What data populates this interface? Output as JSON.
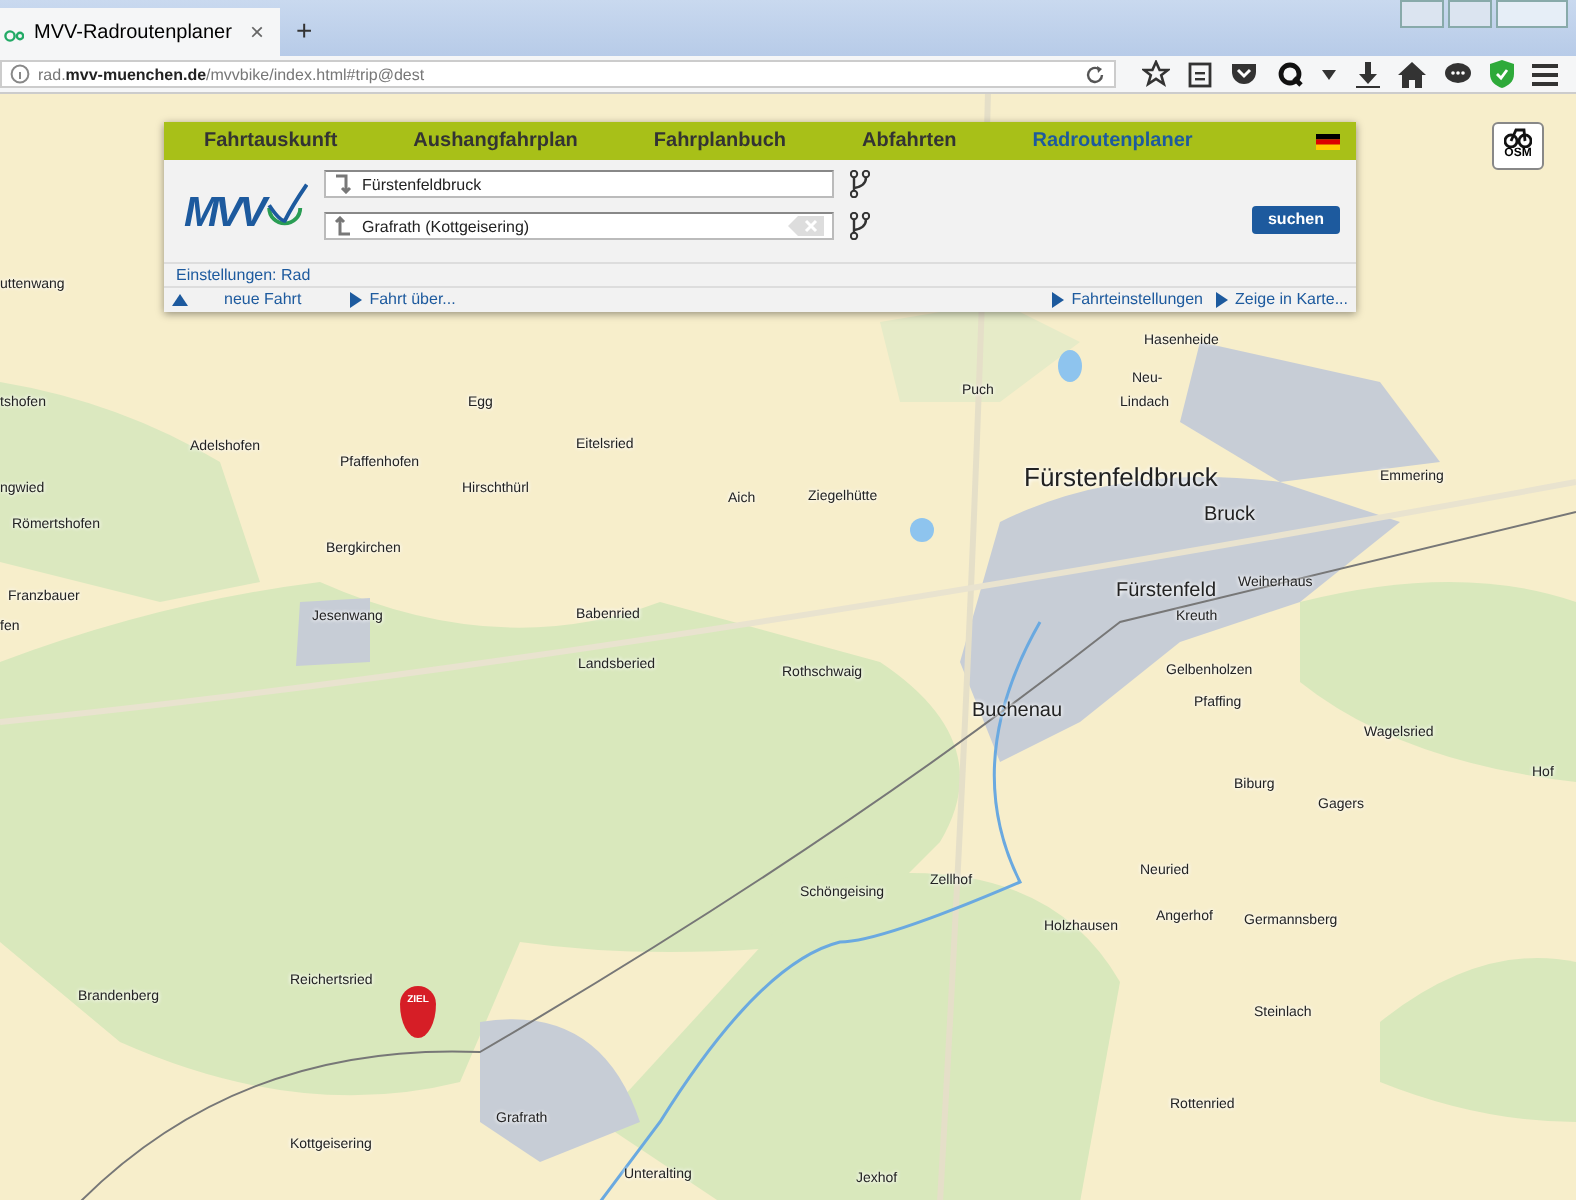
{
  "browser": {
    "tab_title": "MVV-Radroutenplaner",
    "tab_close": "×",
    "new_tab": "+",
    "url": "rad.**mvv-muenchen.de**/mvvbike/index.html#trip@dest"
  },
  "planner": {
    "tabs": [
      {
        "label": "Fahrtauskunft",
        "selected": false
      },
      {
        "label": "Aushangfahrplan",
        "selected": false
      },
      {
        "label": "Fahrplanbuch",
        "selected": false
      },
      {
        "label": "Abfahrten",
        "selected": false
      },
      {
        "label": "Radroutenplaner",
        "selected": true
      }
    ],
    "logo": "MVV",
    "from": {
      "value": "Fürstenfeldbruck"
    },
    "to": {
      "value": "Grafrath (Kottgeisering)"
    },
    "search_button": "suchen",
    "settings": "Einstellungen: Rad",
    "links": [
      {
        "label": "neue Fahrt",
        "kind": "up"
      },
      {
        "label": "Fahrt über...",
        "kind": "right"
      },
      {
        "label": "Fahrteinstellungen",
        "kind": "right"
      },
      {
        "label": "Zeige in Karte...",
        "kind": "right"
      }
    ]
  },
  "osm_button": "OSM",
  "map": {
    "marker": "ZIEL",
    "places": [
      {
        "name": "uttenwang",
        "kind": "village"
      },
      {
        "name": "tshofen",
        "kind": "village"
      },
      {
        "name": "Adelshofen",
        "kind": "village"
      },
      {
        "name": "Egg",
        "kind": "village"
      },
      {
        "name": "Eitelsried",
        "kind": "village"
      },
      {
        "name": "Pfaffenhofen",
        "kind": "village"
      },
      {
        "name": "ngwied",
        "kind": "village"
      },
      {
        "name": "Hirschthürl",
        "kind": "village"
      },
      {
        "name": "Aich",
        "kind": "village"
      },
      {
        "name": "Ziegelhütte",
        "kind": "village"
      },
      {
        "name": "Römertshofen",
        "kind": "village"
      },
      {
        "name": "Bergkirchen",
        "kind": "village"
      },
      {
        "name": "Franzbauer",
        "kind": "village"
      },
      {
        "name": "fen",
        "kind": "village"
      },
      {
        "name": "Jesenwang",
        "kind": "village"
      },
      {
        "name": "Babenried",
        "kind": "village"
      },
      {
        "name": "Landsberied",
        "kind": "village"
      },
      {
        "name": "Rothschwaig",
        "kind": "village"
      },
      {
        "name": "Hasenheide",
        "kind": "village"
      },
      {
        "name": "Puch",
        "kind": "village"
      },
      {
        "name": "Neu-",
        "kind": "village"
      },
      {
        "name": "Lindach",
        "kind": "village"
      },
      {
        "name": "Fürstenfeldbruck",
        "kind": "city"
      },
      {
        "name": "Emmering",
        "kind": "village"
      },
      {
        "name": "Bruck",
        "kind": "town"
      },
      {
        "name": "Fürstenfeld",
        "kind": "town"
      },
      {
        "name": "Weiherhaus",
        "kind": "village"
      },
      {
        "name": "Kreuth",
        "kind": "village"
      },
      {
        "name": "Gelbenholzen",
        "kind": "village"
      },
      {
        "name": "Pfaffing",
        "kind": "village"
      },
      {
        "name": "Buchenau",
        "kind": "town"
      },
      {
        "name": "Wagelsried",
        "kind": "village"
      },
      {
        "name": "Hof",
        "kind": "village"
      },
      {
        "name": "Biburg",
        "kind": "village"
      },
      {
        "name": "Gagers",
        "kind": "village"
      },
      {
        "name": "Neuried",
        "kind": "village"
      },
      {
        "name": "Zellhof",
        "kind": "village"
      },
      {
        "name": "Schöngeising",
        "kind": "village"
      },
      {
        "name": "Holzhausen",
        "kind": "village"
      },
      {
        "name": "Angerhof",
        "kind": "village"
      },
      {
        "name": "Germannsberg",
        "kind": "village"
      },
      {
        "name": "Brandenberg",
        "kind": "village"
      },
      {
        "name": "Reichertsried",
        "kind": "village"
      },
      {
        "name": "Steinlach",
        "kind": "village"
      },
      {
        "name": "Rottenried",
        "kind": "village"
      },
      {
        "name": "Grafrath",
        "kind": "village"
      },
      {
        "name": "Kottgeisering",
        "kind": "village"
      },
      {
        "name": "Unteralting",
        "kind": "village"
      },
      {
        "name": "Jexhof",
        "kind": "village"
      }
    ]
  }
}
